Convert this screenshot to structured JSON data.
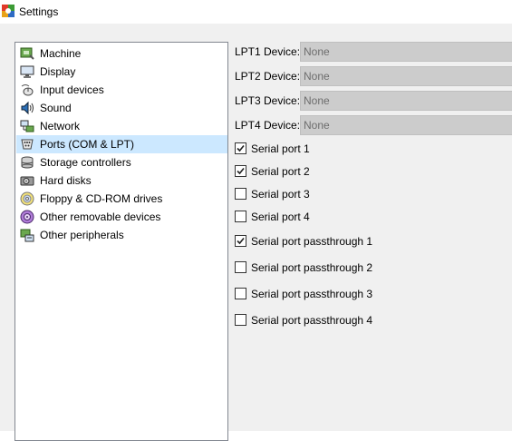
{
  "window": {
    "title": "Settings",
    "icon": "virtualbox-icon"
  },
  "sidebar": {
    "items": [
      {
        "label": "Machine",
        "icon": "machine-icon",
        "selected": false
      },
      {
        "label": "Display",
        "icon": "display-icon",
        "selected": false
      },
      {
        "label": "Input devices",
        "icon": "input-devices-icon",
        "selected": false
      },
      {
        "label": "Sound",
        "icon": "sound-icon",
        "selected": false
      },
      {
        "label": "Network",
        "icon": "network-icon",
        "selected": false
      },
      {
        "label": "Ports (COM & LPT)",
        "icon": "ports-icon",
        "selected": true
      },
      {
        "label": "Storage controllers",
        "icon": "storage-controllers-icon",
        "selected": false
      },
      {
        "label": "Hard disks",
        "icon": "hard-disk-icon",
        "selected": false
      },
      {
        "label": "Floppy & CD-ROM drives",
        "icon": "floppy-cdrom-icon",
        "selected": false
      },
      {
        "label": "Other removable devices",
        "icon": "removable-devices-icon",
        "selected": false
      },
      {
        "label": "Other peripherals",
        "icon": "peripherals-icon",
        "selected": false
      }
    ]
  },
  "lpt": [
    {
      "label": "LPT1 Device:",
      "value": "None"
    },
    {
      "label": "LPT2 Device:",
      "value": "None"
    },
    {
      "label": "LPT3 Device:",
      "value": "None"
    },
    {
      "label": "LPT4 Device:",
      "value": "None"
    }
  ],
  "serial": [
    {
      "label": "Serial port 1",
      "checked": true
    },
    {
      "label": "Serial port 2",
      "checked": true
    },
    {
      "label": "Serial port 3",
      "checked": false
    },
    {
      "label": "Serial port 4",
      "checked": false
    },
    {
      "label": "Serial port passthrough 1",
      "checked": true
    },
    {
      "label": "Serial port passthrough 2",
      "checked": false
    },
    {
      "label": "Serial port passthrough 3",
      "checked": false
    },
    {
      "label": "Serial port passthrough 4",
      "checked": false
    }
  ],
  "colors": {
    "selected_bg": "#cce8ff",
    "disabled_field": "#cccccc",
    "panel_bg": "#f0f0f0"
  }
}
